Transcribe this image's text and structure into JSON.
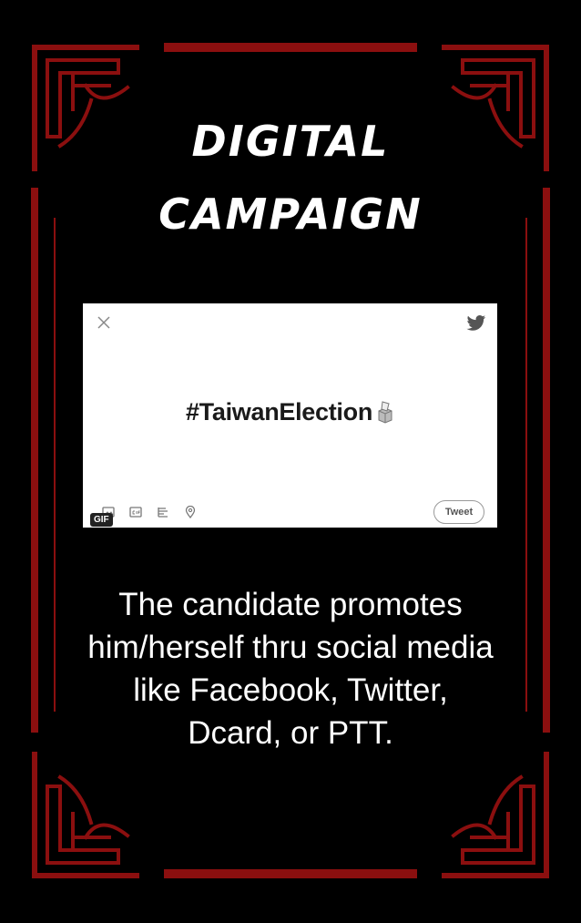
{
  "title": {
    "line1": "DIGITAL",
    "line2": "CAMPAIGN"
  },
  "tweet_card": {
    "hashtag": "#TaiwanElection",
    "tweet_button_label": "Tweet",
    "gif_badge": "GIF",
    "icons": [
      "close-icon",
      "twitter-bird-icon",
      "image-icon",
      "gif-icon",
      "poll-icon",
      "location-icon",
      "ballot-box-icon"
    ]
  },
  "caption": {
    "line1": "The candidate promotes",
    "line2": "him/herself thru social media",
    "line3": "like Facebook, Twitter,",
    "line4": "Dcard, or PTT."
  },
  "colors": {
    "background": "#000000",
    "frame": "#8b0f0f",
    "text": "#ffffff"
  }
}
